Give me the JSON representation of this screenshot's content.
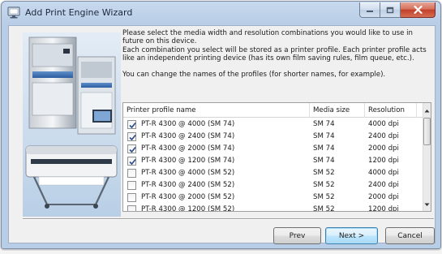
{
  "window": {
    "title": "Add Print Engine Wizard",
    "icon": "monitor-icon"
  },
  "intro": {
    "line1": "Please select the media width and resolution combinations you would like to use in future on this device.",
    "line2": "Each combination you select will be stored as a printer profile. Each printer profile acts like an independent printing device (has its own film saving rules, film queue, etc.).",
    "line3": "You can change the names of the profiles (for shorter names, for example)."
  },
  "table": {
    "columns": [
      "Printer profile name",
      "Media size",
      "Resolution"
    ],
    "rows": [
      {
        "checked": true,
        "name": "PT-R 4300 @ 4000 (SM 74)",
        "media": "SM 74",
        "resolution": "4000 dpi"
      },
      {
        "checked": true,
        "name": "PT-R 4300 @ 2400 (SM 74)",
        "media": "SM 74",
        "resolution": "2400 dpi"
      },
      {
        "checked": true,
        "name": "PT-R 4300 @ 2000 (SM 74)",
        "media": "SM 74",
        "resolution": "2000 dpi"
      },
      {
        "checked": true,
        "name": "PT-R 4300 @ 1200 (SM 74)",
        "media": "SM 74",
        "resolution": "1200 dpi"
      },
      {
        "checked": false,
        "name": "PT-R 4300 @ 4000 (SM 52)",
        "media": "SM 52",
        "resolution": "4000 dpi"
      },
      {
        "checked": false,
        "name": "PT-R 4300 @ 2400 (SM 52)",
        "media": "SM 52",
        "resolution": "2400 dpi"
      },
      {
        "checked": false,
        "name": "PT-R 4300 @ 2000 (SM 52)",
        "media": "SM 52",
        "resolution": "2000 dpi"
      },
      {
        "checked": false,
        "name": "PT-R 4300 @ 1200 (SM 52)",
        "media": "SM 52",
        "resolution": "1200 dpi"
      }
    ]
  },
  "buttons": {
    "prev": "Prev",
    "next": "Next >",
    "cancel": "Cancel"
  },
  "colors": {
    "check": "#2d4d8c",
    "close_button": "#c3402a",
    "default_button_border": "#3c7fb1"
  }
}
